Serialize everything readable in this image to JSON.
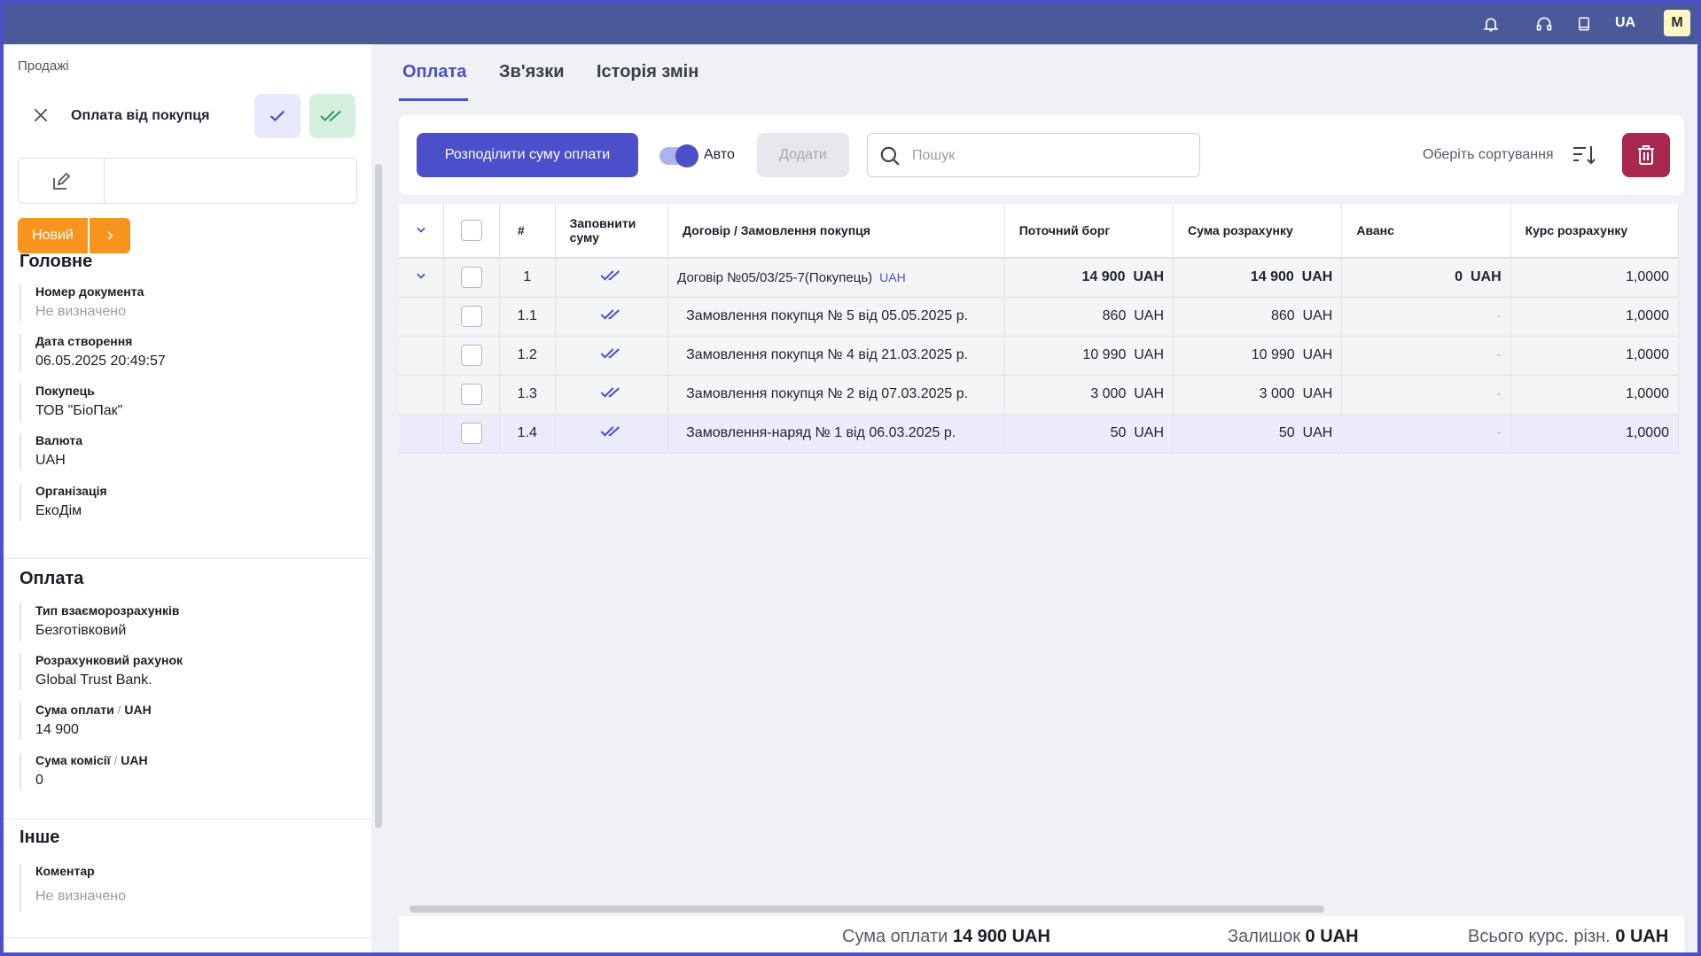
{
  "topbar": {
    "lang": "UA",
    "avatar": "M",
    "icons": [
      "bell-icon",
      "headset-icon",
      "book-icon"
    ]
  },
  "left": {
    "breadcrumb": "Продажі",
    "doc_title": "Оплата від покупця",
    "status": "Новий",
    "sections": {
      "main": {
        "title": "Головне",
        "fields": [
          {
            "label": "Номер документа",
            "value": "Не визначено",
            "muted": true
          },
          {
            "label": "Дата створення",
            "value": "06.05.2025 20:49:57"
          },
          {
            "label": "Покупець",
            "value": "ТОВ \"БіоПак\""
          },
          {
            "label": "Валюта",
            "value": "UAH"
          },
          {
            "label": "Організація",
            "value": "ЕкоДім"
          }
        ]
      },
      "payment": {
        "title": "Оплата",
        "fields": [
          {
            "label": "Тип взаєморозрахунків",
            "value": "Безготівковий"
          },
          {
            "label": "Розрахунковий рахунок",
            "value": "Global Trust Bank."
          },
          {
            "label": "Сума оплати",
            "sep": "/",
            "unit": "UAH",
            "value": "14 900"
          },
          {
            "label": "Сума комісії",
            "sep": "/",
            "unit": "UAH",
            "value": "0"
          }
        ]
      },
      "other": {
        "title": "Інше",
        "fields": [
          {
            "label": "Коментар",
            "value": "Не визначено",
            "muted": true
          }
        ]
      }
    }
  },
  "tabs": [
    "Оплата",
    "Зв'язки",
    "Історія змін"
  ],
  "toolbar": {
    "distribute": "Розподілити суму оплати",
    "auto": "Авто",
    "add": "Додати",
    "search_placeholder": "Пошук",
    "sort": "Оберіть сортування"
  },
  "table": {
    "headers": [
      "#",
      "Заповнити суму",
      "Договір / Замовлення покупця",
      "Поточний борг",
      "Сума розрахунку",
      "Аванс",
      "Курс розрахунку"
    ],
    "rows": [
      {
        "num": "1",
        "name": "Договір №05/03/25-7(Покупець)",
        "currency": "UAH",
        "debt": "14 900  UAH",
        "sum": "14 900  UAH",
        "advance": "0  UAH",
        "rate": "1,0000",
        "kind": "main"
      },
      {
        "num": "1.1",
        "name": "Замовлення покупця № 5 від 05.05.2025 р.",
        "debt": "860  UAH",
        "sum": "860  UAH",
        "advance": "-",
        "rate": "1,0000",
        "kind": "sub"
      },
      {
        "num": "1.2",
        "name": "Замовлення покупця № 4 від 21.03.2025 р.",
        "debt": "10 990  UAH",
        "sum": "10 990  UAH",
        "advance": "-",
        "rate": "1,0000",
        "kind": "sub"
      },
      {
        "num": "1.3",
        "name": "Замовлення покупця № 2 від 07.03.2025 р.",
        "debt": "3 000  UAH",
        "sum": "3 000  UAH",
        "advance": "-",
        "rate": "1,0000",
        "kind": "sub"
      },
      {
        "num": "1.4",
        "name": "Замовлення-наряд № 1 від 06.03.2025 р.",
        "debt": "50  UAH",
        "sum": "50  UAH",
        "advance": "-",
        "rate": "1,0000",
        "kind": "hl"
      }
    ]
  },
  "footer": {
    "sum_label": "Сума оплати",
    "sum_value": "14 900 UAH",
    "rest_label": "Залишок",
    "rest_value": "0 UAH",
    "diff_label": "Всього курс. різн.",
    "diff_value": "0 UAH"
  }
}
